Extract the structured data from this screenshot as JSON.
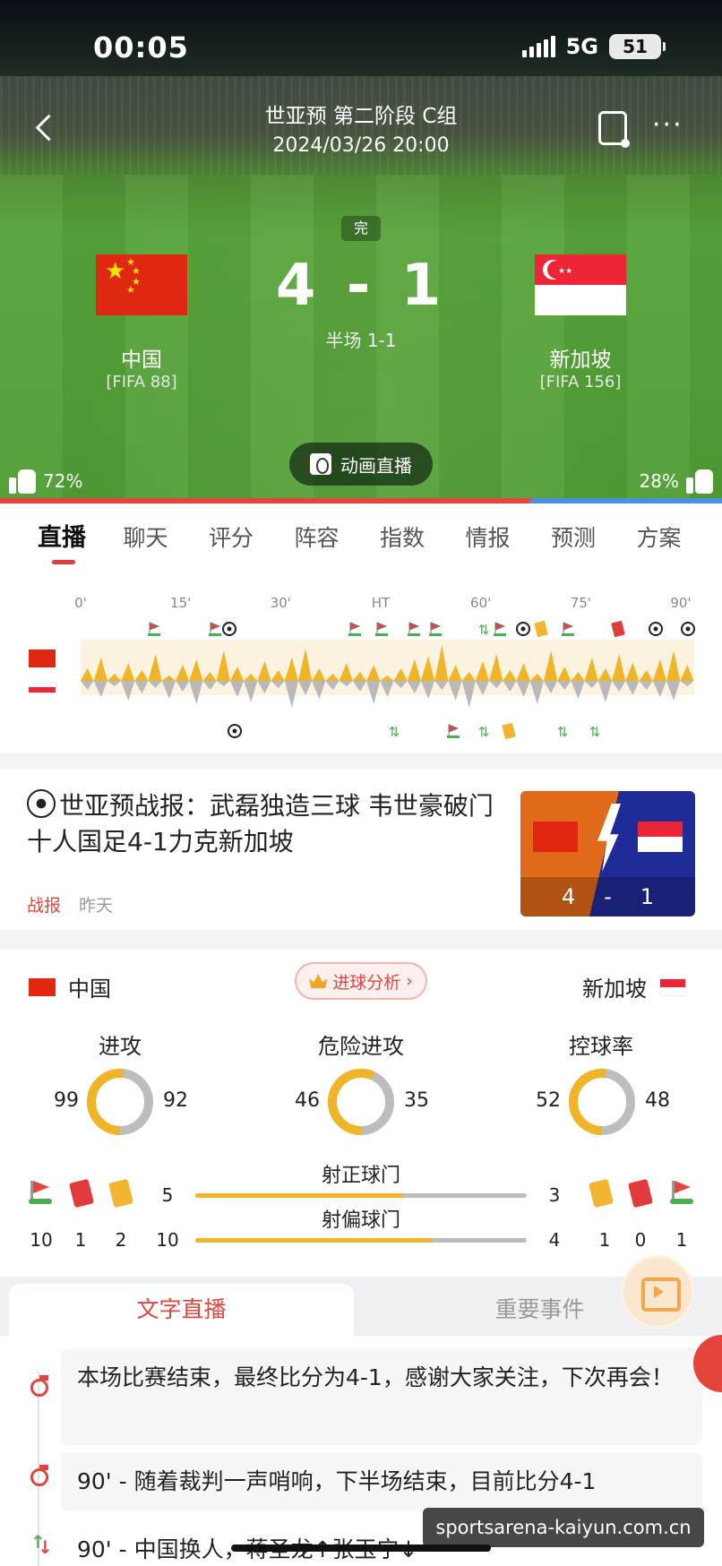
{
  "status_bar": {
    "time": "00:05",
    "network": "5G",
    "battery": "51"
  },
  "header": {
    "title": "世亚预 第二阶段 C组",
    "datetime": "2024/03/26 20:00",
    "status_badge": "完",
    "score": "4 - 1",
    "halftime": "半场 1-1",
    "home": {
      "name": "中国",
      "fifa": "[FIFA 88]"
    },
    "away": {
      "name": "新加坡",
      "fifa": "[FIFA 156]"
    },
    "animation_button": "动画直播",
    "home_vote": "72%",
    "away_vote": "28%",
    "home_vote_fraction": 0.72
  },
  "tabs": [
    "直播",
    "聊天",
    "评分",
    "阵容",
    "指数",
    "情报",
    "预测",
    "方案"
  ],
  "timeline": {
    "ticks": [
      "0'",
      "15'",
      "30'",
      "HT",
      "60'",
      "75'",
      "90'"
    ]
  },
  "news": {
    "title": "世亚预战报：武磊独造三球 韦世豪破门 十人国足4-1力克新加坡",
    "tag": "战报",
    "time": "昨天",
    "thumb_home_score": "4",
    "thumb_sep": "-",
    "thumb_away_score": "1"
  },
  "stats": {
    "home_team": "中国",
    "away_team": "新加坡",
    "analysis_button": "进球分析",
    "donuts": [
      {
        "label": "进攻",
        "home": "99",
        "away": "92",
        "home_value": 99,
        "away_value": 92
      },
      {
        "label": "危险进攻",
        "home": "46",
        "away": "35",
        "home_value": 46,
        "away_value": 35
      },
      {
        "label": "控球率",
        "home": "52",
        "away": "48",
        "home_value": 52,
        "away_value": 48
      }
    ],
    "shots_on_target": {
      "label": "射正球门",
      "home": "5",
      "away": "3",
      "home_value": 5,
      "away_value": 3
    },
    "shots_off_target": {
      "label": "射偏球门",
      "home": "10",
      "away": "4",
      "home_value": 10,
      "away_value": 4
    },
    "home_events": {
      "corners": "10",
      "red": "1",
      "yellow": "2"
    },
    "away_events": {
      "yellow": "1",
      "red": "0",
      "corners": "1"
    }
  },
  "live": {
    "tab_text": "文字直播",
    "tab_events": "重要事件",
    "entries": [
      "本场比赛结束，最终比分为4-1，感谢大家关注，下次再会！",
      "90' - 随着裁判一声哨响，下半场结束，目前比分4-1",
      "90' - 中国换人，蒋圣龙↑张玉宁↓"
    ]
  },
  "watermark": "sportsarena-kaiyun.com.cn",
  "colors": {
    "home": "#f0b429",
    "away": "#bdbdbd",
    "accent": "#e0463f"
  }
}
